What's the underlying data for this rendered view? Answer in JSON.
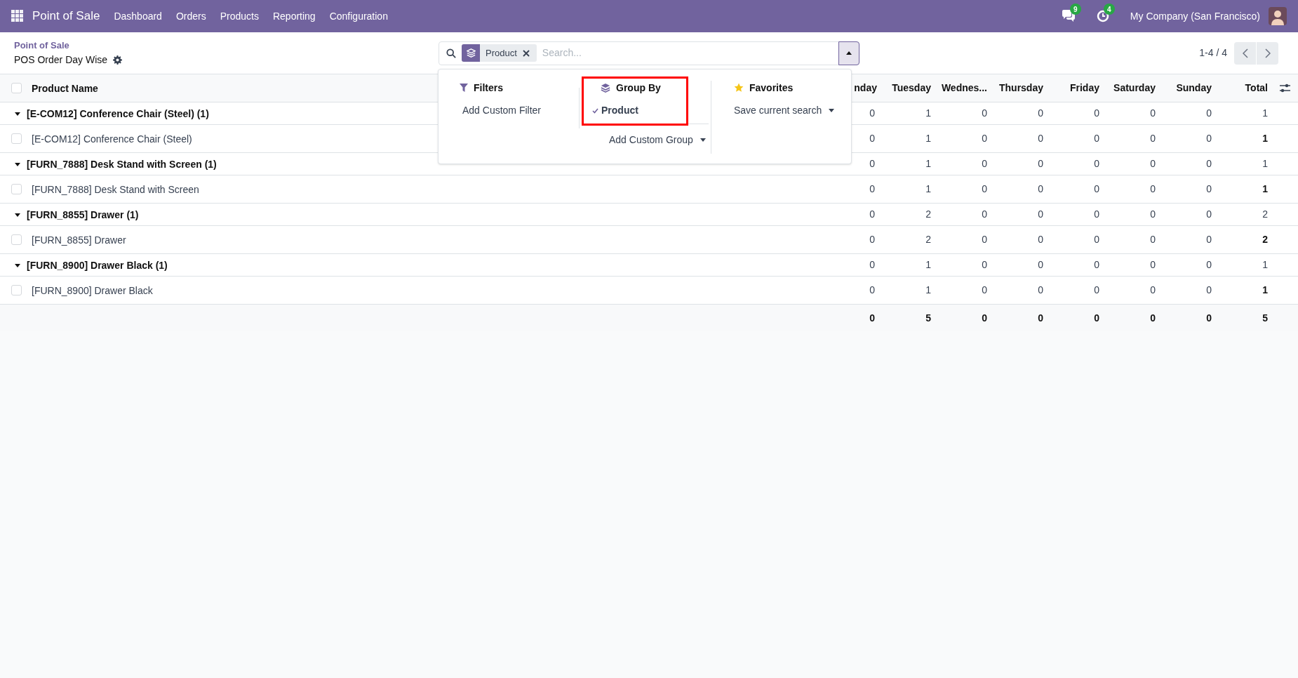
{
  "navbar": {
    "app_name": "Point of Sale",
    "menu": [
      "Dashboard",
      "Orders",
      "Products",
      "Reporting",
      "Configuration"
    ],
    "messages_badge": "9",
    "activities_badge": "4",
    "company": "My Company (San Francisco)"
  },
  "control_panel": {
    "breadcrumb": "Point of Sale",
    "title": "POS Order Day Wise",
    "facet": "Product",
    "search_placeholder": "Search...",
    "pager": "1-4 / 4"
  },
  "search_panel": {
    "filters": {
      "title": "Filters",
      "items": [
        "Add Custom Filter"
      ]
    },
    "group_by": {
      "title": "Group By",
      "options": [
        {
          "label": "Product",
          "checked": true
        }
      ],
      "add": "Add Custom Group"
    },
    "favorites": {
      "title": "Favorites",
      "items": [
        "Save current search"
      ]
    }
  },
  "table": {
    "select_all_checked": false,
    "columns": [
      "Product Name",
      "nday",
      "Tuesday",
      "Wednes...",
      "Thursday",
      "Friday",
      "Saturday",
      "Sunday",
      "Total"
    ],
    "groups": [
      {
        "name": "[E-COM12] Conference Chair (Steel) (1)",
        "expanded": true,
        "values": [
          "0",
          "1",
          "0",
          "0",
          "0",
          "0",
          "0",
          "1"
        ],
        "records": [
          {
            "name": "[E-COM12] Conference Chair (Steel)",
            "checked": false,
            "values": [
              "0",
              "1",
              "0",
              "0",
              "0",
              "0",
              "0",
              "1"
            ]
          }
        ]
      },
      {
        "name": "[FURN_7888] Desk Stand with Screen (1)",
        "expanded": true,
        "values": [
          "0",
          "1",
          "0",
          "0",
          "0",
          "0",
          "0",
          "1"
        ],
        "records": [
          {
            "name": "[FURN_7888] Desk Stand with Screen",
            "checked": false,
            "values": [
              "0",
              "1",
              "0",
              "0",
              "0",
              "0",
              "0",
              "1"
            ]
          }
        ]
      },
      {
        "name": "[FURN_8855] Drawer (1)",
        "expanded": true,
        "values": [
          "0",
          "2",
          "0",
          "0",
          "0",
          "0",
          "0",
          "2"
        ],
        "records": [
          {
            "name": "[FURN_8855] Drawer",
            "checked": false,
            "values": [
              "0",
              "2",
              "0",
              "0",
              "0",
              "0",
              "0",
              "2"
            ]
          }
        ]
      },
      {
        "name": "[FURN_8900] Drawer Black (1)",
        "expanded": true,
        "values": [
          "0",
          "1",
          "0",
          "0",
          "0",
          "0",
          "0",
          "1"
        ],
        "records": [
          {
            "name": "[FURN_8900] Drawer Black",
            "checked": false,
            "values": [
              "0",
              "1",
              "0",
              "0",
              "0",
              "0",
              "0",
              "1"
            ]
          }
        ]
      }
    ],
    "totals": [
      "0",
      "5",
      "0",
      "0",
      "0",
      "0",
      "0",
      "5"
    ]
  }
}
